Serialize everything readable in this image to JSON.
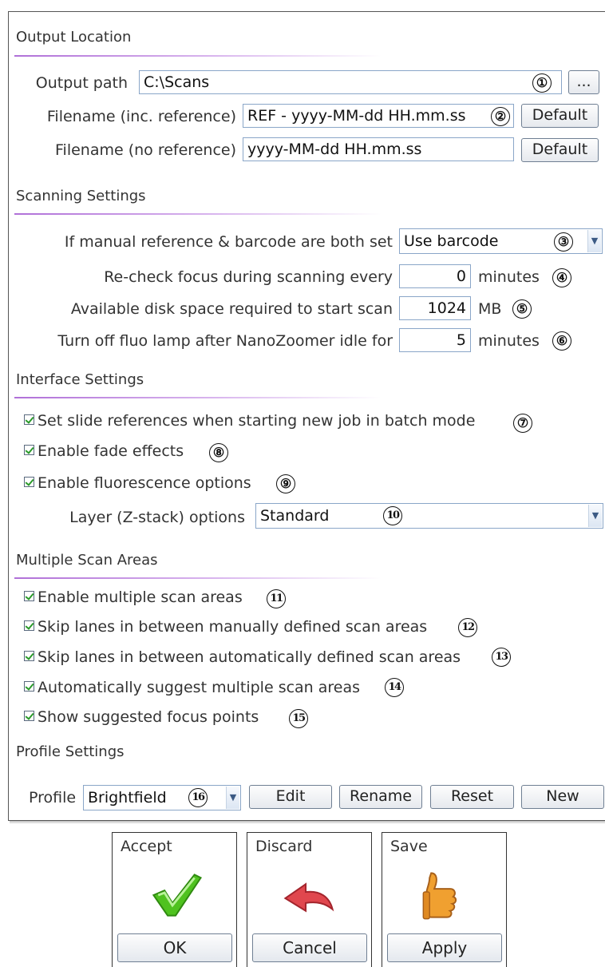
{
  "output_location": {
    "title": "Output Location",
    "output_path_label": "Output path",
    "output_path_value": "C:\\Scans",
    "browse_label": "...",
    "filename_ref_label": "Filename (inc. reference)",
    "filename_ref_value": "REF - yyyy-MM-dd HH.mm.ss",
    "filename_noref_label": "Filename (no reference)",
    "filename_noref_value": "yyyy-MM-dd HH.mm.ss",
    "default_label": "Default"
  },
  "scanning": {
    "title": "Scanning Settings",
    "manual_ref_label": "If manual reference & barcode are both set",
    "manual_ref_value": "Use barcode",
    "recheck_label": "Re-check focus during scanning every",
    "recheck_value": "0",
    "recheck_unit": "minutes",
    "disk_label": "Available disk space required to start scan",
    "disk_value": "1024",
    "disk_unit": "MB",
    "fluo_label": "Turn off fluo lamp after NanoZoomer idle for",
    "fluo_value": "5",
    "fluo_unit": "minutes"
  },
  "interface": {
    "title": "Interface Settings",
    "opt_slide_refs": "Set slide references when starting new job in batch mode",
    "opt_fade": "Enable fade effects",
    "opt_fluor": "Enable fluorescence options",
    "layer_label": "Layer (Z-stack) options",
    "layer_value": "Standard"
  },
  "multi_scan": {
    "title": "Multiple Scan Areas",
    "opt_enable": "Enable multiple scan areas",
    "opt_skip_manual": "Skip lanes in between manually defined scan areas",
    "opt_skip_auto": "Skip lanes in between automatically defined scan areas",
    "opt_suggest": "Automatically suggest multiple scan areas",
    "opt_focus": "Show suggested focus points"
  },
  "profile": {
    "title": "Profile Settings",
    "label": "Profile",
    "value": "Brightfield",
    "edit": "Edit",
    "rename": "Rename",
    "reset": "Reset",
    "new": "New"
  },
  "annotations": [
    "①",
    "②",
    "③",
    "④",
    "⑤",
    "⑥",
    "⑦",
    "⑧",
    "⑨",
    "10",
    "11",
    "12",
    "13",
    "14",
    "15",
    "16"
  ],
  "footer": {
    "accept_title": "Accept",
    "accept_button": "OK",
    "discard_title": "Discard",
    "discard_button": "Cancel",
    "save_title": "Save",
    "save_button": "Apply"
  },
  "colors": {
    "section_line": "#b070d8",
    "checkmark": "#2a9a2a",
    "accept_icon": "#4fc21f",
    "discard_icon": "#e0474e",
    "save_icon": "#f0a030"
  }
}
